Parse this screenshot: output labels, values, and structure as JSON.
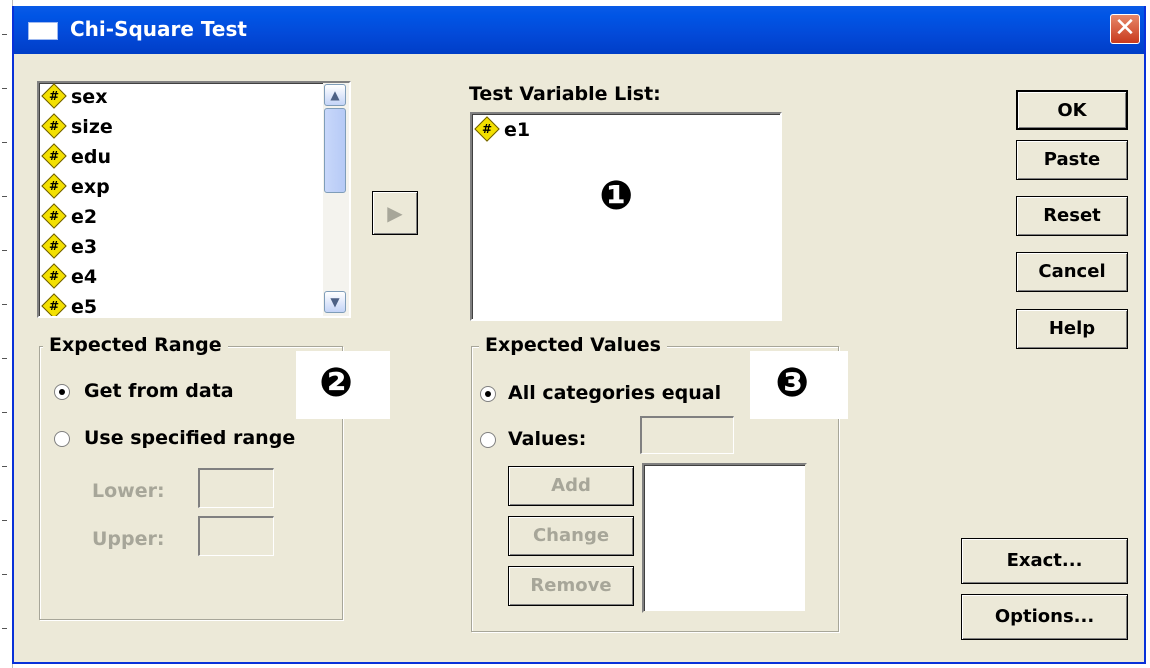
{
  "window": {
    "title": "Chi-Square Test",
    "close_glyph": "✕"
  },
  "source_list": {
    "items": [
      {
        "name": "sex",
        "icon": "#"
      },
      {
        "name": "size",
        "icon": "#"
      },
      {
        "name": "edu",
        "icon": "#"
      },
      {
        "name": "exp",
        "icon": "#"
      },
      {
        "name": "e2",
        "icon": "#"
      },
      {
        "name": "e3",
        "icon": "#"
      },
      {
        "name": "e4",
        "icon": "#"
      },
      {
        "name": "e5",
        "icon": "#"
      }
    ]
  },
  "move_button": {
    "glyph": "▶"
  },
  "test_variable": {
    "label": "Test Variable List:",
    "items": [
      {
        "name": "e1",
        "icon": "#"
      }
    ]
  },
  "buttons": {
    "ok": "OK",
    "paste": "Paste",
    "reset": "Reset",
    "cancel": "Cancel",
    "help": "Help",
    "exact": "Exact...",
    "options": "Options..."
  },
  "expected_range": {
    "legend": "Expected Range",
    "get_from_data": "Get from data",
    "use_specified": "Use specified range",
    "lower_label": "Lower:",
    "upper_label": "Upper:",
    "selected": "get_from_data"
  },
  "expected_values": {
    "legend": "Expected Values",
    "all_equal": "All categories equal",
    "values_label": "Values:",
    "add": "Add",
    "change": "Change",
    "remove": "Remove",
    "selected": "all_equal"
  },
  "markers": [
    "❶",
    "❷",
    "❸"
  ],
  "colors": {
    "title_bar": "#0055e5",
    "dialog_bg": "#ece9d8",
    "variable_icon": "#f3e000",
    "close_button": "#d9542f"
  }
}
